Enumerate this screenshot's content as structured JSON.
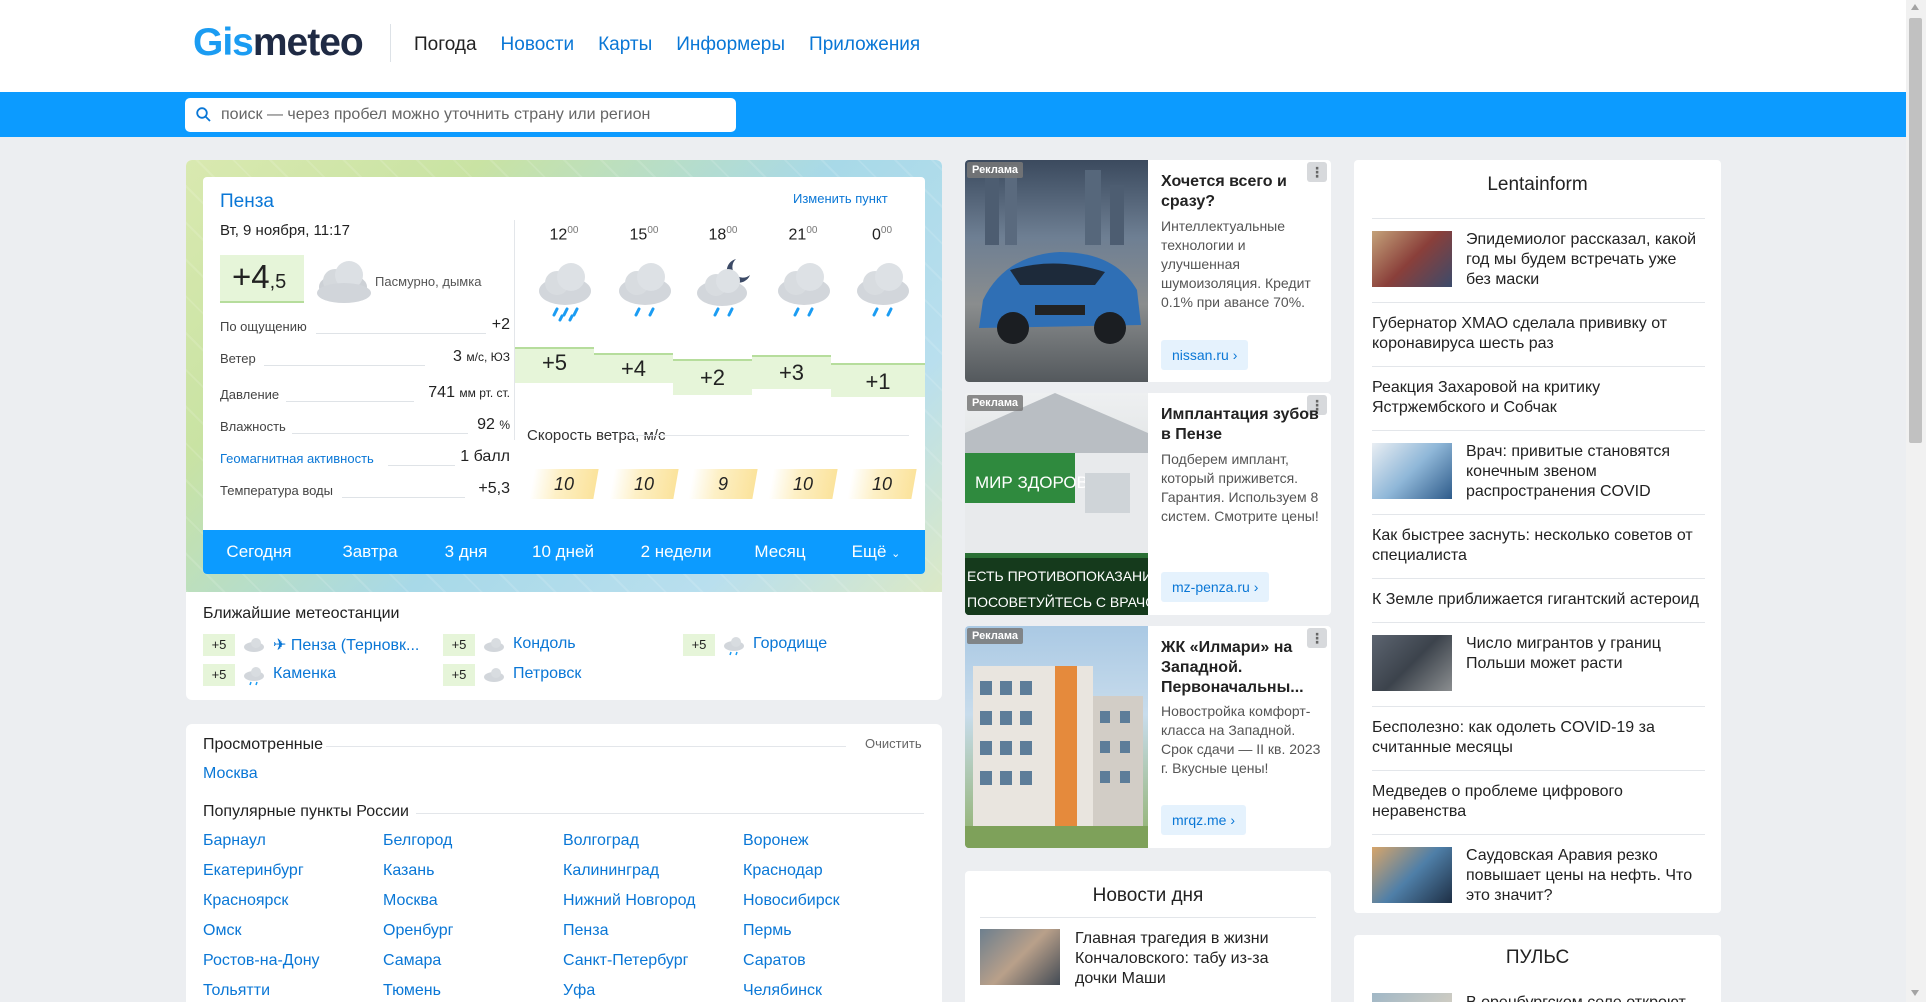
{
  "logo": {
    "part1": "Gis",
    "part2": "meteo"
  },
  "nav": [
    "Погода",
    "Новости",
    "Карты",
    "Информеры",
    "Приложения"
  ],
  "search": {
    "placeholder": "поиск — через пробел можно уточнить страну или регион"
  },
  "weather": {
    "city": "Пенза",
    "change": "Изменить пункт",
    "date": "Вт, 9 ноября, 11:17",
    "temp_main": "+4",
    "temp_frac": ",5",
    "condition": "Пасмурно, дымка",
    "params": [
      {
        "label": "По ощущению",
        "value": "+2",
        "unit": ""
      },
      {
        "label": "Ветер",
        "value": "3",
        "unit": "м/с, ЮЗ"
      },
      {
        "label": "Давление",
        "value": "741",
        "unit": "мм рт. ст."
      },
      {
        "label": "Влажность",
        "value": "92",
        "unit": "%"
      },
      {
        "label": "Геомагнитная активность",
        "value": "1 балл",
        "unit": ""
      },
      {
        "label": "Температура воды",
        "value": "+5,3",
        "unit": ""
      }
    ],
    "hours": [
      {
        "h": "12",
        "m": "00",
        "temp": "+5",
        "wind": "10"
      },
      {
        "h": "15",
        "m": "00",
        "temp": "+4",
        "wind": "10"
      },
      {
        "h": "18",
        "m": "00",
        "temp": "+2",
        "wind": "9"
      },
      {
        "h": "21",
        "m": "00",
        "temp": "+3",
        "wind": "10"
      },
      {
        "h": "0",
        "m": "00",
        "temp": "+1",
        "wind": "10"
      }
    ],
    "wind_label": "Скорость ветра, м/с",
    "tabs": [
      "Сегодня",
      "Завтра",
      "3 дня",
      "10 дней",
      "2 недели",
      "Месяц",
      "Ещё"
    ]
  },
  "stations": {
    "title": "Ближайшие метеостанции",
    "items": [
      {
        "temp": "+5",
        "name": "✈ Пенза (Терновк..."
      },
      {
        "temp": "+5",
        "name": "Кондоль"
      },
      {
        "temp": "+5",
        "name": "Городище"
      },
      {
        "temp": "+5",
        "name": "Каменка"
      },
      {
        "temp": "+5",
        "name": "Петровск"
      }
    ]
  },
  "viewed": {
    "title": "Просмотренные",
    "clear": "Очистить",
    "cities": [
      "Москва"
    ]
  },
  "popular": {
    "title": "Популярные пункты России",
    "cities": [
      "Барнаул",
      "Белгород",
      "Волгоград",
      "Воронеж",
      "Екатеринбург",
      "Казань",
      "Калининград",
      "Краснодар",
      "Красноярск",
      "Москва",
      "Нижний Новгород",
      "Новосибирск",
      "Омск",
      "Оренбург",
      "Пенза",
      "Пермь",
      "Ростов-на-Дону",
      "Самара",
      "Санкт-Петербург",
      "Саратов",
      "Тольятти",
      "Тюмень",
      "Уфа",
      "Челябинск"
    ]
  },
  "ads": [
    {
      "tag": "Реклама",
      "title": "Хочется всего и сразу?",
      "text": "Интеллектуальные технологии и улучшенная шумоизоляция. Кредит 0.1% при авансе 70%.",
      "button": "nissan.ru ›"
    },
    {
      "tag": "Реклама",
      "title": "Имплантация зубов в Пензе",
      "text": "Подберем имплант, который приживется. Гарантия. Используем 8 систем. Смотрите цены!",
      "button": "mz-penza.ru ›",
      "img_text1": "МИР ЗДОРОВЬЯ",
      "img_text2": "ЕСТЬ ПРОТИВОПОКАЗАНИЯ",
      "img_text3": "ПОСОВЕТУЙТЕСЬ С ВРАЧОМ"
    },
    {
      "tag": "Реклама",
      "title": "ЖК «Илмари» на Западной. Первоначальны...",
      "text": "Новостройка комфорт-класса на Западной. Срок сдачи — II кв. 2023 г. Вкусные цены!",
      "button": "mrqz.me ›"
    }
  ],
  "news_day": {
    "title": "Новости дня",
    "items": [
      "Главная трагедия в жизни Кончаловского: табу из-за дочки Маши"
    ]
  },
  "lenta": {
    "title": "Lentainform",
    "items": [
      {
        "text": "Эпидемиолог рассказал, какой год мы будем встречать уже без маски"
      },
      {
        "text": "Губернатор ХМАО сделала прививку от коронавируса шесть раз"
      },
      {
        "text": "Реакция Захаровой на критику Ястржембского и Собчак"
      },
      {
        "text": "Врач: привитые становятся конечным звеном распространения COVID"
      },
      {
        "text": "Как быстрее заснуть: несколько советов от специалиста"
      },
      {
        "text": "К Земле приближается гигантский астероид"
      },
      {
        "text": "Число мигрантов у границ Польши может расти"
      },
      {
        "text": "Бесполезно: как одолеть COVID-19 за считанные месяцы"
      },
      {
        "text": "Медведев о проблеме цифрового неравенства"
      },
      {
        "text": "Саудовская Аравия резко повышает цены на нефть. Что это значит?"
      }
    ]
  },
  "puls": {
    "title": "ПУЛЬС",
    "text": "В оренбургском селе откроют"
  }
}
